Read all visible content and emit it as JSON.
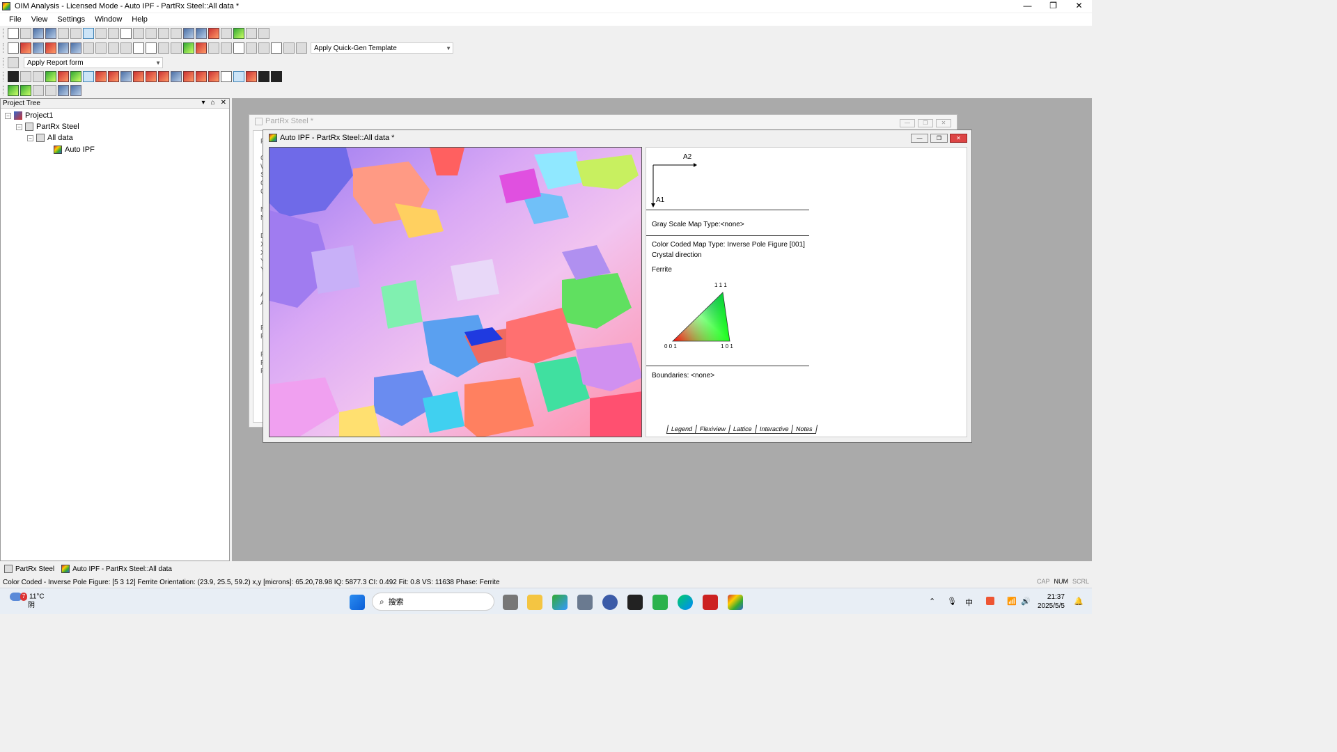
{
  "window": {
    "title": "OIM Analysis - Licensed Mode - Auto IPF - PartRx Steel::All data *",
    "controls": [
      "—",
      "❐",
      "✕"
    ]
  },
  "menu": [
    "File",
    "View",
    "Settings",
    "Window",
    "Help"
  ],
  "toolbars": {
    "quick_gen_template": "Apply Quick-Gen Template",
    "report_form": "Apply Report form"
  },
  "project_tree": {
    "header": "Project Tree",
    "header_controls": [
      "▾",
      "⌂",
      "✕"
    ],
    "items": [
      {
        "label": "Project1",
        "expander": "−"
      },
      {
        "label": "PartRx Steel",
        "expander": "−"
      },
      {
        "label": "All data",
        "expander": "−"
      },
      {
        "label": "Auto IPF",
        "expander": ""
      }
    ]
  },
  "back_window": {
    "title": "PartRx Steel *",
    "side_letters": [
      "F",
      "C",
      "W",
      "S",
      "C",
      "C",
      "N",
      "N",
      "D",
      "X",
      "X",
      "Y",
      "Y",
      "A",
      "A",
      "F",
      "F",
      "F",
      "F",
      "F"
    ]
  },
  "front_window": {
    "title": "Auto IPF - PartRx Steel::All data *",
    "controls": [
      "—",
      "❐",
      "✕"
    ]
  },
  "legend": {
    "axis_a2": "A2",
    "axis_a1": "A1",
    "gray_scale": "Gray Scale Map Type:<none>",
    "color_coded": "Color Coded Map Type: Inverse Pole Figure [001]",
    "crystal_direction": "Crystal direction",
    "phase": "Ferrite",
    "tri_top": "1 1 1",
    "tri_left": "0 0 1",
    "tri_right": "1 0 1",
    "boundaries": "Boundaries: <none>",
    "tabs": [
      "Legend",
      "Flexiview",
      "Lattice",
      "Interactive",
      "Notes"
    ]
  },
  "task_strip": [
    "PartRx Steel",
    "Auto IPF - PartRx Steel::All data"
  ],
  "status": {
    "text": "Color Coded - Inverse Pole Figure: [5 3 12] Ferrite   Orientation: (23.9, 25.5, 59.2)   x,y [microns]: 65.20,78.98   IQ: 5877.3   CI: 0.492   Fit: 0.8   VS: 11638   Phase: Ferrite",
    "indicators": [
      "CAP",
      "NUM",
      "SCRL"
    ]
  },
  "taskbar": {
    "weather_temp": "11°C",
    "weather_desc": "阴",
    "weather_badge": "7",
    "search_placeholder": "搜索",
    "time": "21:37",
    "date": "2025/5/5",
    "ime": "中"
  },
  "colors": {
    "mdi_bg": "#aaaaaa",
    "close_red": "#dd4444",
    "map_base": "#c9a0f0"
  }
}
